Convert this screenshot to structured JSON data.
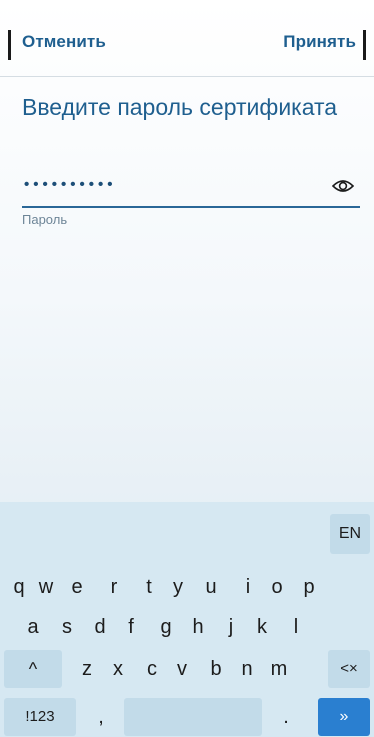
{
  "header": {
    "cancel_label": "Отменить",
    "accept_label": "Принять"
  },
  "prompt": {
    "title": "Введите пароль сертификата"
  },
  "password_field": {
    "masked_value": "••••••••••",
    "helper_label": "Пароль",
    "reveal_icon": "eye-icon"
  },
  "keyboard": {
    "language": "EN",
    "row1": [
      "q",
      "w",
      "e",
      "r",
      "t",
      "y",
      "u",
      "i",
      "o",
      "p"
    ],
    "row2": [
      "a",
      "s",
      "d",
      "f",
      "g",
      "h",
      "j",
      "k",
      "l"
    ],
    "row3": [
      "z",
      "x",
      "c",
      "v",
      "b",
      "n",
      "m"
    ],
    "shift_label": "^",
    "backspace_label": "<×",
    "symbols_label": "!123",
    "comma_label": ",",
    "period_label": ".",
    "enter_label": "»"
  },
  "colors": {
    "accent": "#1f5f8f",
    "keyboard_bg": "#d6e8f2",
    "key_box": "#c2dbe9",
    "enter_key": "#2a7fd0"
  }
}
